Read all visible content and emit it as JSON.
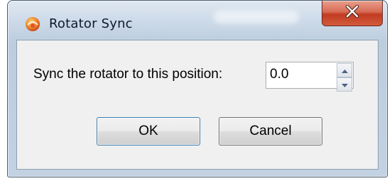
{
  "window": {
    "title": "Rotator Sync",
    "blurred_background_title": "Rotator Control"
  },
  "titlebar": {
    "app_icon": "app-logo-icon",
    "close_icon": "close-icon"
  },
  "form": {
    "prompt_label": "Sync the rotator to this position:",
    "position_value": "0.0"
  },
  "buttons": {
    "ok_label": "OK",
    "cancel_label": "Cancel"
  },
  "colors": {
    "close_button": "#c23c22",
    "client_background": "#f0f0f0",
    "frame": "#bccdde"
  }
}
